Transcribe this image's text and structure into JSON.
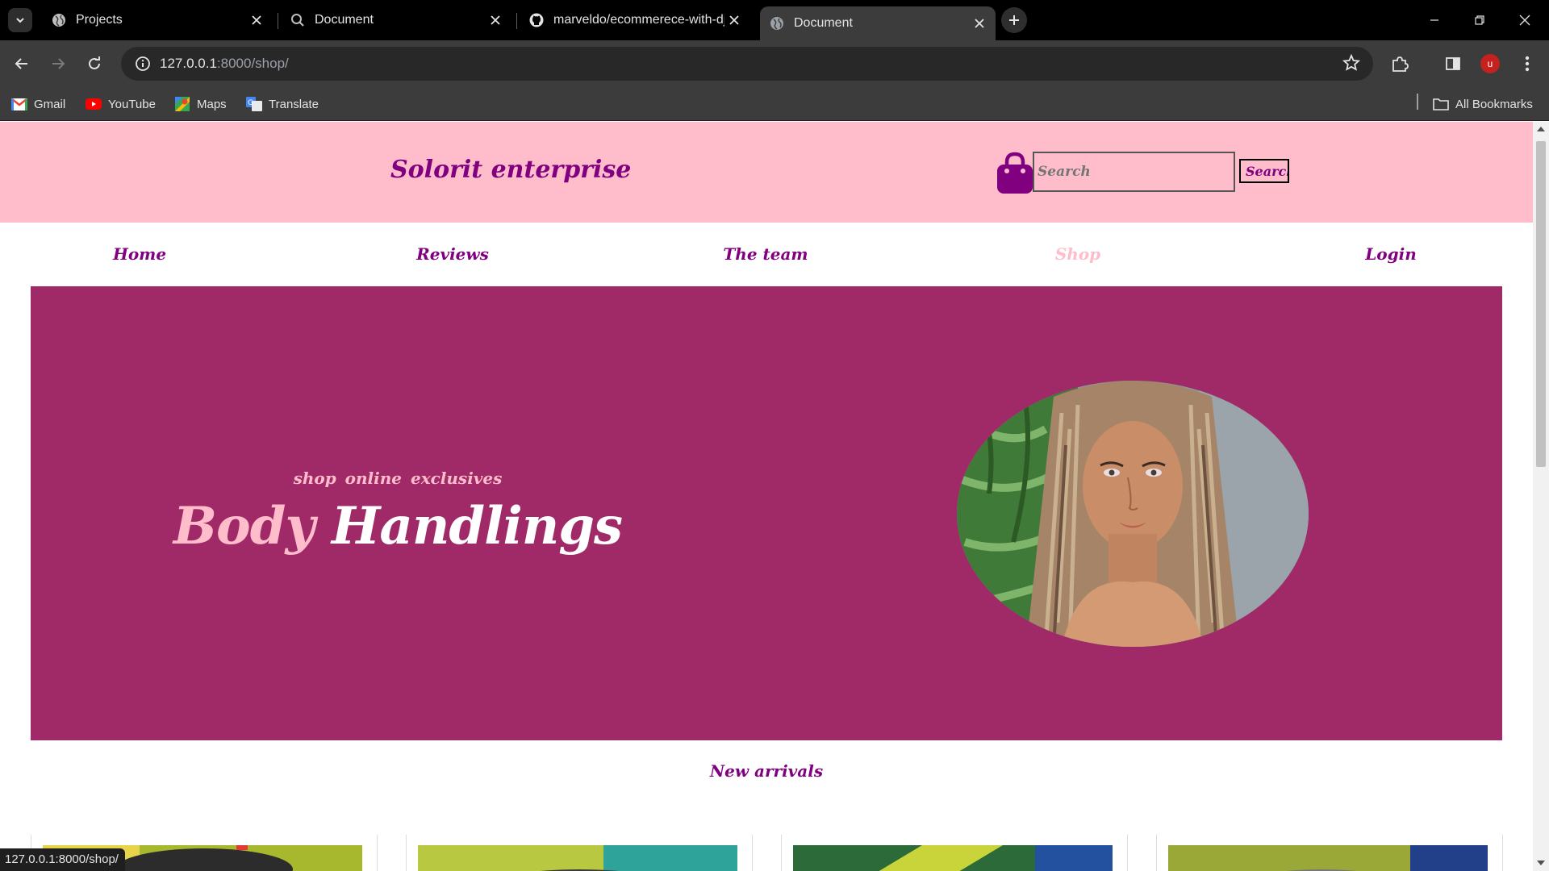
{
  "browser": {
    "tabs": [
      {
        "title": "Projects",
        "icon": "globe-icon"
      },
      {
        "title": "Document",
        "icon": "search-icon"
      },
      {
        "title": "marveldo/ecommerece-with-dj",
        "icon": "github-icon"
      },
      {
        "title": "Document",
        "icon": "globe-icon",
        "active": true
      }
    ],
    "url_host": "127.0.0.1",
    "url_path": ":8000/shop/",
    "profile_initial": "u",
    "bookmarks": [
      "Gmail",
      "YouTube",
      "Maps",
      "Translate"
    ],
    "all_bookmarks": "All Bookmarks",
    "status_url": "127.0.0.1:8000/shop/"
  },
  "site": {
    "brand": "Solorit enterprise",
    "search_placeholder": "Search",
    "search_button": "Search",
    "nav": [
      "Home",
      "Reviews",
      "The team",
      "Shop",
      "Login"
    ],
    "active_nav": "Shop",
    "hero": {
      "kicker": "shop online exclusives",
      "title_part1": "Body",
      "title_part2": "Handlings"
    },
    "section_title": "New arrivals"
  },
  "colors": {
    "header_bg": "#ffbdcb",
    "brand_purple": "#800080",
    "hero_bg": "#a02a68",
    "accent_pink": "#ffbdcb"
  }
}
